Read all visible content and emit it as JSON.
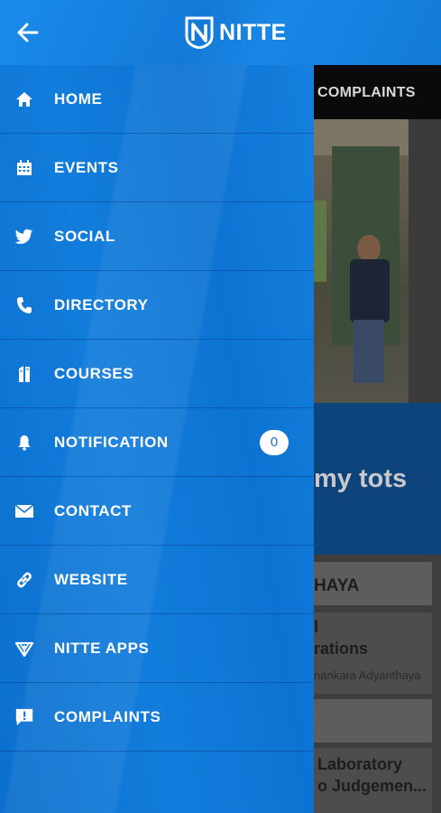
{
  "app": {
    "title": "NITTE",
    "back_icon": "arrow-left-icon",
    "accent": "#1583e3",
    "drawer_color": "#0f78d8"
  },
  "background": {
    "tab_label": "COMPLAINTS",
    "banner_text": "my tots",
    "card1_heading": "HAYA",
    "card1_line1": "l",
    "card1_line2": "rations",
    "card1_line3": "nankara Adyanthaya",
    "card2_line1": "Laboratory",
    "card2_line2": "o Judgemen..."
  },
  "menu": [
    {
      "label": "HOME",
      "icon": "home-icon"
    },
    {
      "label": "EVENTS",
      "icon": "calendar-icon"
    },
    {
      "label": "SOCIAL",
      "icon": "twitter-icon"
    },
    {
      "label": "DIRECTORY",
      "icon": "phone-icon"
    },
    {
      "label": "COURSES",
      "icon": "books-icon"
    },
    {
      "label": "NOTIFICATION",
      "icon": "bell-icon",
      "badge": "0"
    },
    {
      "label": "CONTACT",
      "icon": "envelope-icon"
    },
    {
      "label": "WEBSITE",
      "icon": "link-icon"
    },
    {
      "label": "NITTE APPS",
      "icon": "apps-icon"
    },
    {
      "label": "COMPLAINTS",
      "icon": "complaint-icon"
    }
  ]
}
